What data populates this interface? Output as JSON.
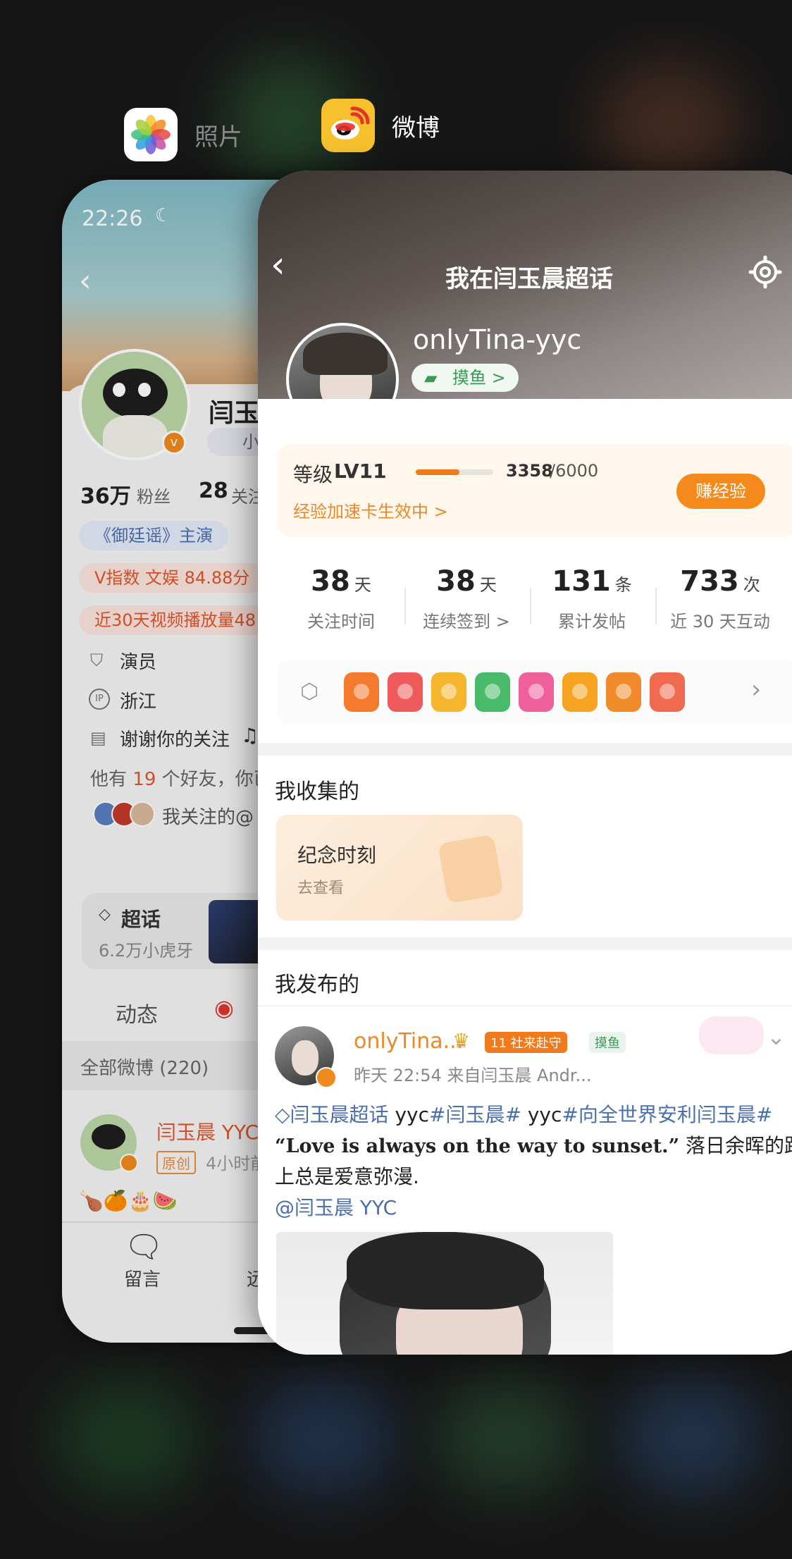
{
  "switcher": {
    "apps": [
      {
        "name": "照片",
        "icon": "photos-icon"
      },
      {
        "name": "微博",
        "icon": "weibo-icon"
      }
    ]
  },
  "photos_card": {
    "status_time": "22:26",
    "profile_name": "闫玉",
    "chip_partial": "小",
    "fans_count": "36万",
    "fans_label": "粉丝",
    "follow_count": "28",
    "follow_label": "关注",
    "tag_drama": "《御廷谣》主演",
    "v_index": "V指数 文娱 84.88分",
    "play_stat": "近30天视频播放量48",
    "info": {
      "role": "演员",
      "region": "浙江",
      "bio": "谢谢你的关注"
    },
    "friends_pre": "他有",
    "friends_count": "19",
    "friends_post": "个好友，你已",
    "follow_also": "我关注的@",
    "supertopic": {
      "title": "超话",
      "sub": "6.2万小虎牙"
    },
    "tabs": {
      "dynamic": "动态"
    },
    "all_posts": "全部微博 (220)",
    "post": {
      "author": "闫玉晨 YYC",
      "badge": "原创",
      "time": "4小时前"
    },
    "post_emojis": "🍗🍊🎂🍉",
    "bottom": {
      "comment": "留言",
      "other": "远"
    }
  },
  "weibo_card": {
    "page_title": "我在闫玉晨超话",
    "username": "onlyTina-yyc",
    "fish_tag": "摸鱼 >",
    "level": {
      "label": "等级",
      "value": "LV11",
      "progress": 0.5595,
      "current": "3358",
      "total": "/6000"
    },
    "speedup": "经验加速卡生效中 >",
    "earn_button": "赚经验",
    "stats": [
      {
        "num": "38",
        "unit": "天",
        "label": "关注时间"
      },
      {
        "num": "38",
        "unit": "天",
        "label": "连续签到 >"
      },
      {
        "num": "131",
        "unit": "条",
        "label": "累计发帖"
      },
      {
        "num": "733",
        "unit": "次",
        "label": "近 30 天互动"
      }
    ],
    "badge_colors": [
      "#f57a2e",
      "#ef5b5b",
      "#f5b62e",
      "#49b96a",
      "#ef5f9a",
      "#f5a320",
      "#f08a2a",
      "#ef6a4e"
    ],
    "collected_title": "我收集的",
    "collected_card": {
      "title": "纪念时刻",
      "sub": "去查看"
    },
    "published_title": "我发布的",
    "post": {
      "author": "onlyTina...",
      "badge_keeper": "11 社来赴守",
      "badge_fish": "摸鱼",
      "meta": "昨天 22:54  来自闫玉晨 Andr...",
      "line1_topic": "闫玉晨超话",
      "line1_rest_a": " yyc",
      "line1_tag_a": "#闫玉晨#",
      "line1_rest_b": " yyc",
      "line1_tag_b": "#向全世界安利闫玉晨#",
      "quote": "“Love is always on the way to sunset.”",
      "line2_rest": " 落日余晖的路",
      "line3": "上总是爱意弥漫.",
      "mention": "@闫玉晨 YYC"
    }
  }
}
